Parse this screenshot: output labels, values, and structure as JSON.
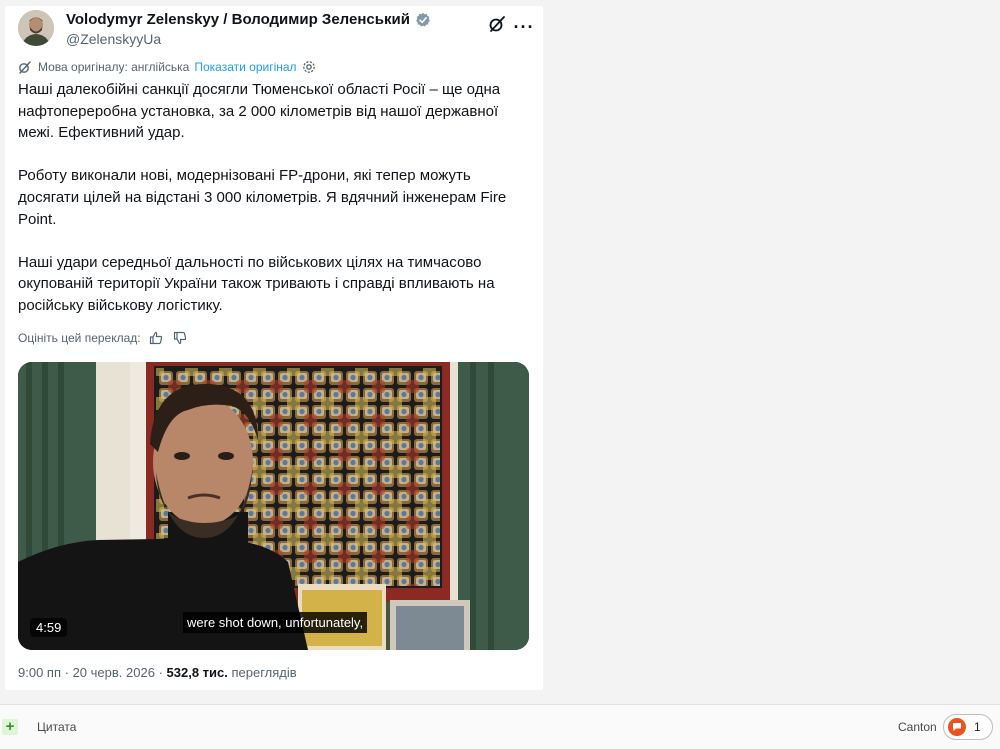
{
  "author": {
    "name": "Volodymyr Zelenskyy / Володимир Зеленський",
    "handle": "@ZelenskyyUa"
  },
  "translation": {
    "source_label": "Мова оригіналу: англійська",
    "show_original": "Показати оригінал"
  },
  "tweet": {
    "paragraphs": [
      "Наші далекобійні санкції досягли Тюменської області Росії – ще одна нафтопереробна установка, за 2 000 кілометрів від нашої державної межі. Ефективний удар.",
      "Роботу виконали нові, модернізовані FP-дрони, які тепер можуть досягати цілей на відстані 3 000 кілометрів. Я вдячний інженерам Fire Point.",
      "Наші удари середньої дальності по військових цілях на тимчасово окупованій території України також тривають і справді впливають на російську військову логістику."
    ]
  },
  "rate": {
    "label": "Оцініть цей переклад:"
  },
  "video": {
    "duration": "4:59",
    "subtitle": "were shot down, unfortunately,"
  },
  "meta": {
    "time": "9:00 пп",
    "date": "20 черв. 2026",
    "views": "532,8 тис.",
    "views_label": "переглядів"
  },
  "bottom": {
    "plus": "+",
    "quote": "Цитата",
    "canton": "Canton",
    "reply_count": "1"
  },
  "icons": [
    "verified-icon",
    "grok-icon",
    "more-icon",
    "translate-icon",
    "settings-icon",
    "thumbs-up-icon",
    "thumbs-down-icon",
    "reply-icon"
  ],
  "colors": {
    "accent": "#1d9bf0",
    "text": "#0f1419",
    "muted": "#536471",
    "reply_badge": "#e8531f"
  }
}
